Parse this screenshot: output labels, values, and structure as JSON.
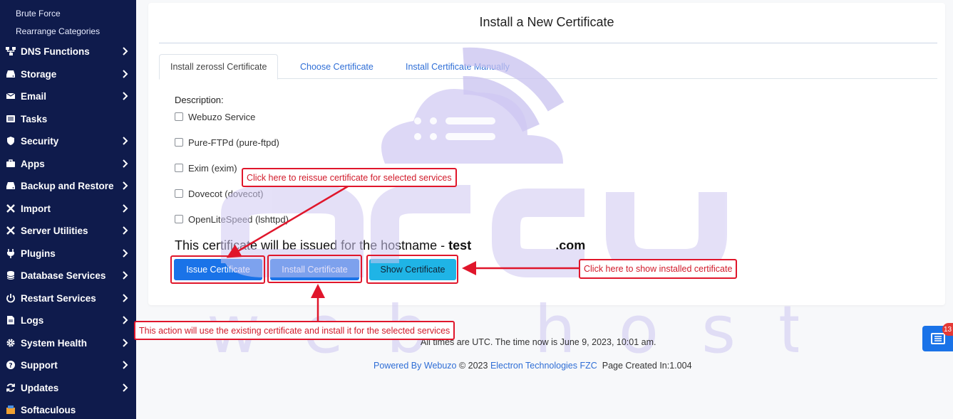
{
  "sidebar": {
    "sub_items": [
      {
        "label": "Brute Force"
      },
      {
        "label": "Rearrange Categories"
      }
    ],
    "items": [
      {
        "label": "DNS Functions",
        "icon": "sitemap-icon",
        "has_chevron": true
      },
      {
        "label": "Storage",
        "icon": "hard-drive-icon",
        "has_chevron": true
      },
      {
        "label": "Email",
        "icon": "envelope-icon",
        "has_chevron": true
      },
      {
        "label": "Tasks",
        "icon": "list-icon",
        "has_chevron": false
      },
      {
        "label": "Security",
        "icon": "shield-icon",
        "has_chevron": true
      },
      {
        "label": "Apps",
        "icon": "briefcase-icon",
        "has_chevron": true
      },
      {
        "label": "Backup and Restore",
        "icon": "hard-drive-icon",
        "has_chevron": true
      },
      {
        "label": "Import",
        "icon": "tools-icon",
        "has_chevron": true
      },
      {
        "label": "Server Utilities",
        "icon": "tools-icon",
        "has_chevron": true
      },
      {
        "label": "Plugins",
        "icon": "plug-icon",
        "has_chevron": true
      },
      {
        "label": "Database Services",
        "icon": "database-icon",
        "has_chevron": true
      },
      {
        "label": "Restart Services",
        "icon": "power-icon",
        "has_chevron": true
      },
      {
        "label": "Logs",
        "icon": "file-icon",
        "has_chevron": true
      },
      {
        "label": "System Health",
        "icon": "gear-icon",
        "has_chevron": true
      },
      {
        "label": "Support",
        "icon": "question-icon",
        "has_chevron": true
      },
      {
        "label": "Updates",
        "icon": "refresh-icon",
        "has_chevron": true
      },
      {
        "label": "Softaculous",
        "icon": "softaculous-icon",
        "has_chevron": false
      }
    ]
  },
  "card": {
    "title": "Install a New Certificate",
    "tabs": [
      {
        "label": "Install zerossl Certificate",
        "active": true
      },
      {
        "label": "Choose Certificate",
        "active": false
      },
      {
        "label": "Install Certificate Manually",
        "active": false
      }
    ],
    "description_label": "Description:",
    "services": [
      {
        "label": "Webuzo Service",
        "checked": false
      },
      {
        "label": "Pure-FTPd (pure-ftpd)",
        "checked": false
      },
      {
        "label": "Exim (exim)",
        "checked": false
      },
      {
        "label": "Dovecot (dovecot)",
        "checked": false
      },
      {
        "label": "OpenLiteSpeed (lshttpd)",
        "checked": false
      }
    ],
    "hostname_text": "This certificate will be issued for the hostname - ",
    "hostname_prefix": "test",
    "hostname_suffix": ".com",
    "buttons": {
      "issue": "Issue Certificate",
      "install": "Install Certificate",
      "show": "Show Certificate"
    }
  },
  "footer": {
    "time_text": "All times are UTC. The time now is June 9, 2023, 10:01 am.",
    "powered_by": "Powered By Webuzo",
    "copyright": " © 2023 ",
    "company": "Electron Technologies FZC",
    "page_created": "  Page Created In:1.004"
  },
  "floating_widget": {
    "badge_count": "13"
  },
  "annotations": {
    "reissue": "Click here to reissue certificate for selected services",
    "show_installed": "Click here to show installed certificate",
    "install_existing": "This action will use the existing certificate and install it for the selected services"
  },
  "colors": {
    "sidebar_bg": "#0f1b4c",
    "primary": "#1a73e8",
    "info": "#1fb4e6",
    "annotation_red": "#e0162b",
    "link": "#2f6ed6"
  }
}
